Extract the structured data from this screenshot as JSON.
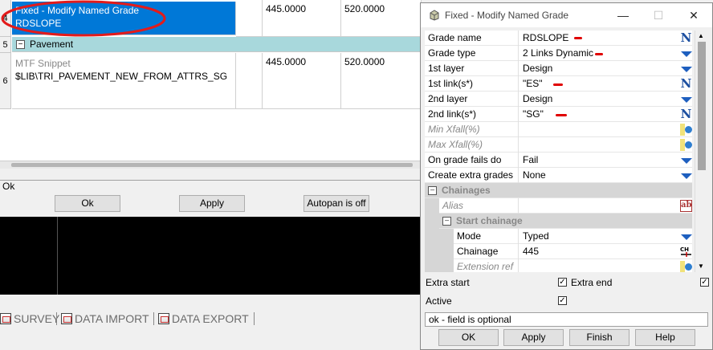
{
  "grid": {
    "rows": [
      {
        "num": "4",
        "line1": "Fixed - Modify Named Grade",
        "line2": "RDSLOPE",
        "v1": "445.0000",
        "v2": "520.0000"
      },
      {
        "num": "5",
        "group": "Pavement"
      },
      {
        "num": "6",
        "line1": "MTF Snippet",
        "line2": "$LIB\\TRI_PAVEMENT_NEW_FROM_ATTRS_SG",
        "v1": "445.0000",
        "v2": "520.0000"
      }
    ]
  },
  "status_label": "Ok",
  "buttons": {
    "ok": "Ok",
    "apply": "Apply",
    "autopan": "Autopan is off"
  },
  "tabs": [
    {
      "label": "SURVEY",
      "icon": "survey-icon"
    },
    {
      "label": "DATA IMPORT",
      "icon": "data-import-icon"
    },
    {
      "label": "DATA EXPORT",
      "icon": "data-export-icon"
    }
  ],
  "dialog": {
    "title": "Fixed - Modify Named Grade",
    "window_controls": {
      "minimize": "—",
      "maximize": "☐",
      "close": "✕"
    },
    "properties": [
      {
        "label": "Grade name",
        "value": "RDSLOPE",
        "icon": "name-icon"
      },
      {
        "label": "Grade type",
        "value": "2 Links Dynamic",
        "icon": "dropdown-icon"
      },
      {
        "label": "1st layer",
        "value": "Design",
        "icon": "dropdown-icon"
      },
      {
        "label": "1st link(s*)",
        "value": "\"ES\"",
        "icon": "name-icon"
      },
      {
        "label": "2nd layer",
        "value": "Design",
        "icon": "dropdown-icon"
      },
      {
        "label": "2nd link(s*)",
        "value": "\"SG\"",
        "icon": "name-icon"
      },
      {
        "label": "Min Xfall(%)",
        "value": "",
        "icon": "slider-icon",
        "optional": true
      },
      {
        "label": "Max Xfall(%)",
        "value": "",
        "icon": "slider-icon",
        "optional": true
      },
      {
        "label": "On grade fails do",
        "value": "Fail",
        "icon": "dropdown-icon"
      },
      {
        "label": "Create extra grades",
        "value": "None",
        "icon": "dropdown-icon"
      }
    ],
    "group_chainages": "Chainages",
    "alias": {
      "label": "Alias",
      "icon": "ab-icon"
    },
    "group_start": "Start  chainage",
    "start_props": [
      {
        "label": "Mode",
        "value": "Typed",
        "icon": "dropdown-icon"
      },
      {
        "label": "Chainage",
        "value": "445",
        "icon": "chainage-icon"
      },
      {
        "label": "Extension ref",
        "value": "",
        "icon": "slider-icon",
        "optional": true
      }
    ],
    "extra_start": {
      "label": "Extra start",
      "checked": true
    },
    "extra_end": {
      "label": "Extra end",
      "checked": true
    },
    "active": {
      "label": "Active",
      "checked": true
    },
    "status": "ok - field is optional",
    "buttons": {
      "ok": "OK",
      "apply": "Apply",
      "finish": "Finish",
      "help": "Help"
    }
  }
}
